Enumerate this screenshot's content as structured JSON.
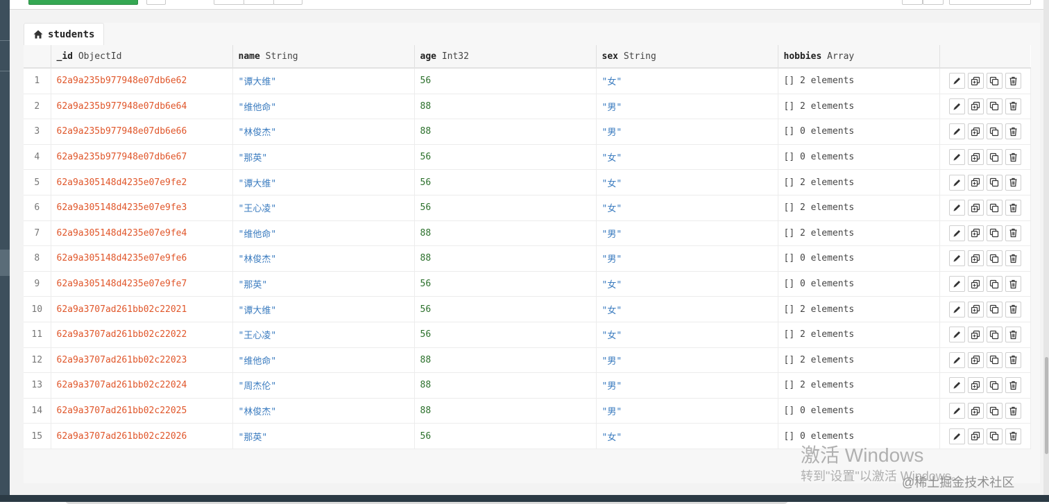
{
  "collection": {
    "name": "students"
  },
  "columns": [
    {
      "field": "_id",
      "type": "ObjectId"
    },
    {
      "field": "name",
      "type": "String"
    },
    {
      "field": "age",
      "type": "Int32"
    },
    {
      "field": "sex",
      "type": "String"
    },
    {
      "field": "hobbies",
      "type": "Array"
    }
  ],
  "rows": [
    {
      "n": "1",
      "id": "62a9a235b977948e07db6e62",
      "name": "\"谭大维\"",
      "age": "56",
      "sex": "\"女\"",
      "hobbies": "[] 2 elements"
    },
    {
      "n": "2",
      "id": "62a9a235b977948e07db6e64",
      "name": "\"维他命\"",
      "age": "88",
      "sex": "\"男\"",
      "hobbies": "[] 2 elements"
    },
    {
      "n": "3",
      "id": "62a9a235b977948e07db6e66",
      "name": "\"林俊杰\"",
      "age": "88",
      "sex": "\"男\"",
      "hobbies": "[] 0 elements"
    },
    {
      "n": "4",
      "id": "62a9a235b977948e07db6e67",
      "name": "\"那英\"",
      "age": "56",
      "sex": "\"女\"",
      "hobbies": "[] 0 elements"
    },
    {
      "n": "5",
      "id": "62a9a305148d4235e07e9fe2",
      "name": "\"谭大维\"",
      "age": "56",
      "sex": "\"女\"",
      "hobbies": "[] 2 elements"
    },
    {
      "n": "6",
      "id": "62a9a305148d4235e07e9fe3",
      "name": "\"王心凌\"",
      "age": "56",
      "sex": "\"女\"",
      "hobbies": "[] 2 elements"
    },
    {
      "n": "7",
      "id": "62a9a305148d4235e07e9fe4",
      "name": "\"维他命\"",
      "age": "88",
      "sex": "\"男\"",
      "hobbies": "[] 2 elements"
    },
    {
      "n": "8",
      "id": "62a9a305148d4235e07e9fe6",
      "name": "\"林俊杰\"",
      "age": "88",
      "sex": "\"男\"",
      "hobbies": "[] 0 elements"
    },
    {
      "n": "9",
      "id": "62a9a305148d4235e07e9fe7",
      "name": "\"那英\"",
      "age": "56",
      "sex": "\"女\"",
      "hobbies": "[] 0 elements"
    },
    {
      "n": "10",
      "id": "62a9a3707ad261bb02c22021",
      "name": "\"谭大维\"",
      "age": "56",
      "sex": "\"女\"",
      "hobbies": "[] 2 elements"
    },
    {
      "n": "11",
      "id": "62a9a3707ad261bb02c22022",
      "name": "\"王心凌\"",
      "age": "56",
      "sex": "\"女\"",
      "hobbies": "[] 2 elements"
    },
    {
      "n": "12",
      "id": "62a9a3707ad261bb02c22023",
      "name": "\"维他命\"",
      "age": "88",
      "sex": "\"男\"",
      "hobbies": "[] 2 elements"
    },
    {
      "n": "13",
      "id": "62a9a3707ad261bb02c22024",
      "name": "\"周杰伦\"",
      "age": "88",
      "sex": "\"男\"",
      "hobbies": "[] 2 elements"
    },
    {
      "n": "14",
      "id": "62a9a3707ad261bb02c22025",
      "name": "\"林俊杰\"",
      "age": "88",
      "sex": "\"男\"",
      "hobbies": "[] 0 elements"
    },
    {
      "n": "15",
      "id": "62a9a3707ad261bb02c22026",
      "name": "\"那英\"",
      "age": "56",
      "sex": "\"女\"",
      "hobbies": "[] 0 elements"
    }
  ],
  "row_actions": [
    "edit-icon",
    "clone-icon",
    "copy-icon",
    "delete-icon"
  ],
  "watermark": {
    "line1": "激活 Windows",
    "line2": "转到\"设置\"以激活 Windows。"
  },
  "credit": "@稀土掘金技术社区",
  "colors": {
    "objectid": "#e0562a",
    "string": "#3a7bbf",
    "int": "#2a6f2a",
    "primary": "#35a853"
  }
}
